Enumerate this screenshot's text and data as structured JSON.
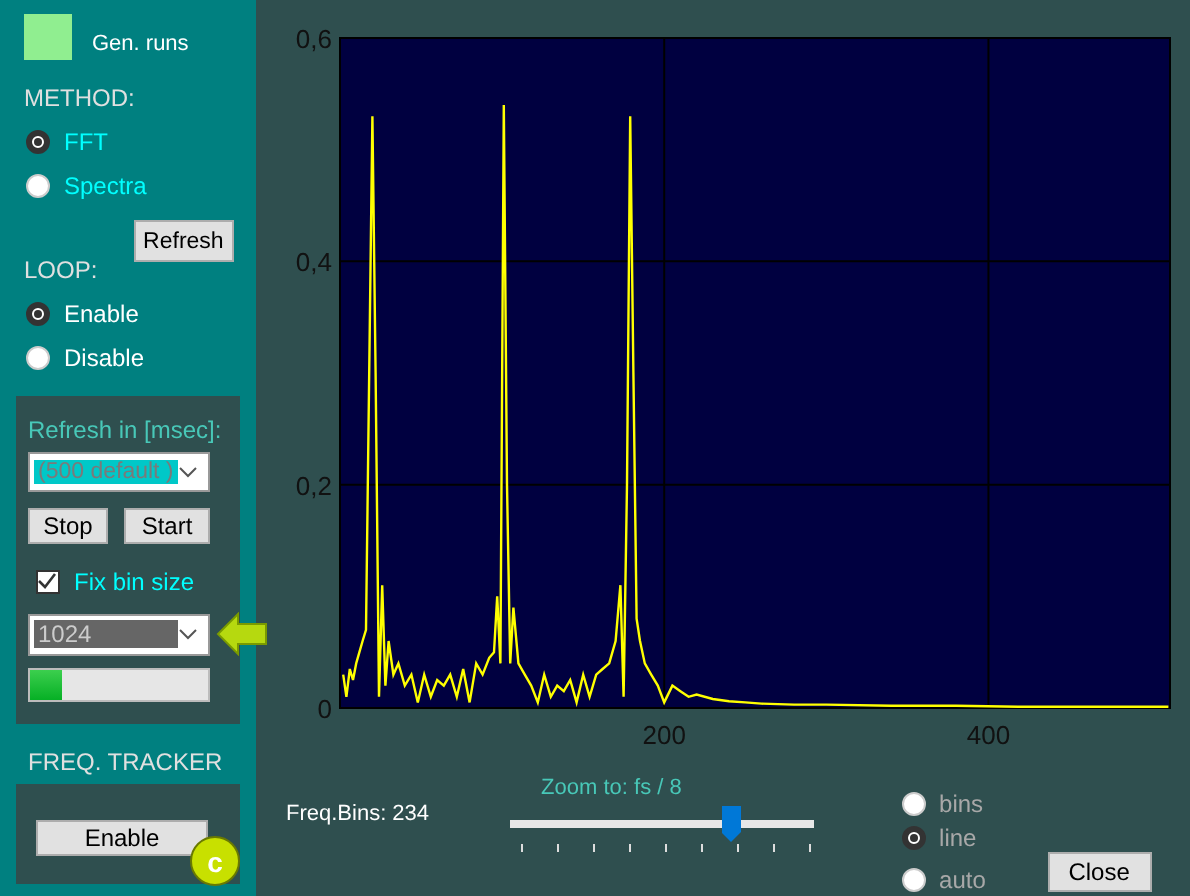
{
  "gen_runs": {
    "label": "Gen. runs"
  },
  "method": {
    "label": "METHOD:",
    "options": [
      {
        "label": "FFT",
        "selected": true
      },
      {
        "label": "Spectra",
        "selected": false
      }
    ]
  },
  "refresh_button": "Refresh",
  "loop": {
    "label": "LOOP:",
    "options": [
      {
        "label": "Enable",
        "selected": true
      },
      {
        "label": "Disable",
        "selected": false
      }
    ]
  },
  "refresh_panel": {
    "label": "Refresh in [msec]:",
    "interval": "(500 default )",
    "buttons": [
      "Stop",
      "Start"
    ],
    "fix_bin_size": {
      "label": "Fix bin size",
      "checked": true
    },
    "bin_size": "1024",
    "progress": {
      "level": 0.18
    }
  },
  "freq_tracker": {
    "label": "FREQ. TRACKER",
    "button": "Enable",
    "badge": "c"
  },
  "chart": {
    "chart_data": {
      "type": "line",
      "grid": true,
      "xlim": [
        0,
        512
      ],
      "ylim": [
        0,
        0.6
      ],
      "xticks": [
        200,
        400
      ],
      "yticks": [
        {
          "value": 0,
          "label": "0"
        },
        {
          "value": 0.2,
          "label": "0,2"
        },
        {
          "value": 0.4,
          "label": "0,4"
        },
        {
          "value": 0.6,
          "label": "0,6"
        }
      ],
      "x": [
        2,
        4,
        6,
        8,
        10,
        12,
        14,
        16,
        18,
        20,
        22,
        24,
        26,
        28,
        30,
        33,
        36,
        40,
        44,
        48,
        52,
        56,
        60,
        64,
        68,
        72,
        76,
        80,
        84,
        88,
        92,
        95,
        97,
        99,
        101,
        103,
        105,
        107,
        110,
        114,
        118,
        122,
        126,
        130,
        134,
        138,
        142,
        146,
        150,
        154,
        158,
        162,
        166,
        170,
        173,
        175,
        177,
        179,
        181,
        183,
        185,
        188,
        192,
        196,
        200,
        205,
        210,
        215,
        220,
        230,
        240,
        250,
        260,
        280,
        300,
        340,
        380,
        420,
        460,
        511
      ],
      "series": [
        {
          "color": "#ffff00",
          "values": [
            0.03,
            0.01,
            0.035,
            0.025,
            0.04,
            0.05,
            0.06,
            0.07,
            0.3,
            0.53,
            0.3,
            0.01,
            0.11,
            0.02,
            0.06,
            0.03,
            0.04,
            0.02,
            0.03,
            0.005,
            0.03,
            0.01,
            0.025,
            0.02,
            0.03,
            0.01,
            0.035,
            0.005,
            0.04,
            0.03,
            0.045,
            0.05,
            0.1,
            0.04,
            0.54,
            0.2,
            0.04,
            0.09,
            0.04,
            0.03,
            0.02,
            0.005,
            0.03,
            0.01,
            0.02,
            0.015,
            0.025,
            0.005,
            0.03,
            0.01,
            0.03,
            0.035,
            0.04,
            0.06,
            0.11,
            0.01,
            0.2,
            0.53,
            0.3,
            0.08,
            0.06,
            0.04,
            0.03,
            0.02,
            0.005,
            0.02,
            0.015,
            0.01,
            0.012,
            0.008,
            0.006,
            0.005,
            0.004,
            0.003,
            0.003,
            0.002,
            0.002,
            0.001,
            0.001,
            0.001
          ]
        }
      ]
    }
  },
  "freq_bins": "Freq.Bins: 234",
  "zoom": {
    "label": "Zoom to: fs / 8",
    "level": 0.73
  },
  "display_mode": [
    {
      "label": "bins",
      "selected": false
    },
    {
      "label": "line",
      "selected": true
    },
    {
      "label": "auto",
      "selected": false
    }
  ],
  "close_button": "Close"
}
